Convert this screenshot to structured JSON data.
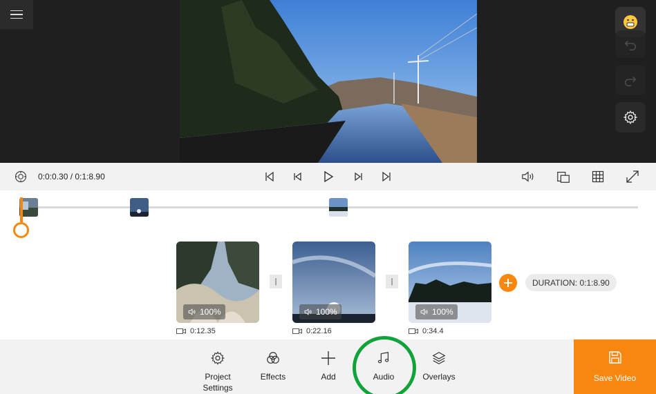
{
  "menu": {
    "icon": "hamburger-menu-icon"
  },
  "preview": {
    "side_buttons": [
      "emoji-icon",
      "undo-icon",
      "redo-icon",
      "settings-icon"
    ]
  },
  "transport": {
    "time": "0:0:0.30 / 0:1:8.90",
    "icons": [
      "timer-icon",
      "skip-start-icon",
      "step-back-icon",
      "play-icon",
      "step-forward-icon",
      "skip-end-icon",
      "volume-icon",
      "aspect-ratio-icon",
      "grid-icon",
      "fullscreen-icon"
    ]
  },
  "clips": [
    {
      "volume": "100%",
      "duration": "0:12.35"
    },
    {
      "volume": "100%",
      "duration": "0:22.16"
    },
    {
      "volume": "100%",
      "duration": "0:34.4"
    }
  ],
  "separator_glyph": "|",
  "total_duration": "DURATION: 0:1:8.90",
  "toolbar": {
    "project_settings": "Project\nSettings",
    "effects": "Effects",
    "add": "Add",
    "audio": "Audio",
    "overlays": "Overlays",
    "save_video": "Save Video"
  },
  "colors": {
    "accent": "#f7870f",
    "highlight": "#10a33a"
  }
}
